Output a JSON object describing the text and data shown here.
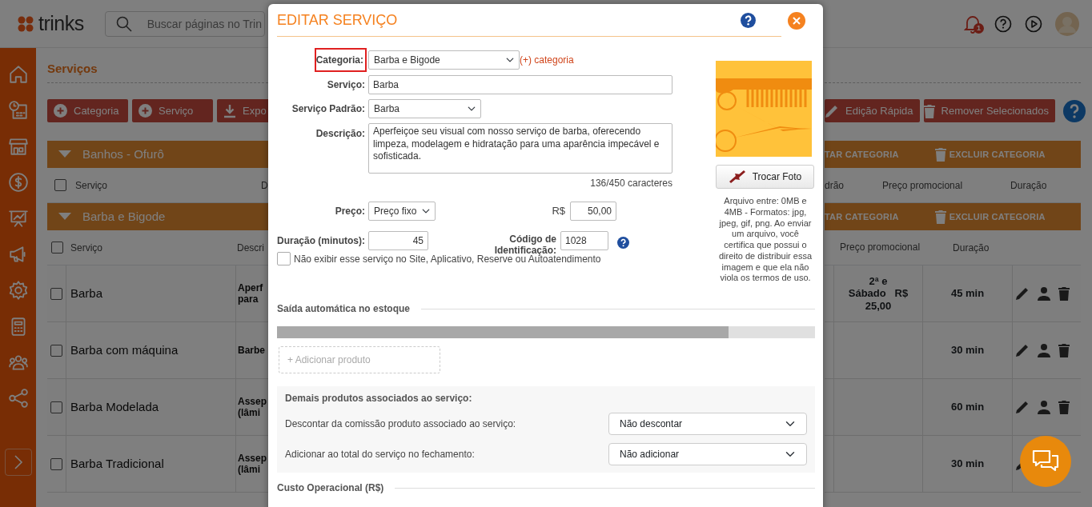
{
  "header": {
    "logo": "trinks",
    "search": {
      "placeholder": "Buscar páginas no Trin"
    },
    "notifications": "1"
  },
  "page": {
    "title": "Serviços",
    "toolbar_left": [
      {
        "label": "Categoria",
        "kind": "add"
      },
      {
        "label": "Serviço",
        "kind": "add"
      },
      {
        "label": "Expo",
        "kind": "export"
      }
    ],
    "toolbar_right": [
      {
        "label": "Edição Rápida",
        "kind": "edit"
      },
      {
        "label": "Remover Selecionados",
        "kind": "remove"
      }
    ],
    "categories": [
      {
        "name": "Banhos - Ofurô",
        "expanded": true,
        "edit_action": "TAR CATEGORIA",
        "delete_action": "EXCLUIR CATEGORIA",
        "all_checked": false,
        "columns_left": [
          "Serviço",
          "D"
        ],
        "columns_right": [
          "drão",
          "Preço promocional",
          "Duração"
        ]
      },
      {
        "name": "Barba e Bigode",
        "expanded": true,
        "edit_action": "TAR CATEGORIA",
        "delete_action": "EXCLUIR CATEGORIA",
        "all_checked": false,
        "columns_left": [
          "Serviço",
          "Descri"
        ],
        "columns_right": [
          "Preço promocional",
          "Duração"
        ],
        "rows": [
          {
            "name": "Barba",
            "checked": false,
            "description_lines": [
              "Aperf",
              "para"
            ],
            "promo_lines": [
              "2ª e",
              "Sábado   R$",
              "25,00"
            ],
            "duration": "45 min",
            "actions": [
              {
                "kind": "edit"
              },
              {
                "kind": "professional"
              },
              {
                "kind": "delete"
              }
            ]
          },
          {
            "name": "Barba com máquina",
            "checked": false,
            "description_lines": [
              "Barbe"
            ],
            "promo_lines": [],
            "duration": "30 min",
            "actions": [
              {
                "kind": "edit"
              },
              {
                "kind": "professional"
              },
              {
                "kind": "delete"
              }
            ]
          },
          {
            "name": "Barba Modelada",
            "checked": false,
            "description_lines": [
              "Assep",
              "(lâmi"
            ],
            "promo_lines": [],
            "duration": "60 min",
            "actions": [
              {
                "kind": "edit"
              },
              {
                "kind": "professional"
              },
              {
                "kind": "delete"
              }
            ]
          },
          {
            "name": "Barba Tradicional",
            "checked": false,
            "description_lines": [
              "Assep",
              "(lâmi"
            ],
            "promo_lines": [],
            "duration": "30 min",
            "actions": [
              {
                "kind": "edit"
              }
            ]
          }
        ]
      }
    ]
  },
  "modal": {
    "title": "EDITAR SERVIÇO",
    "categoria": {
      "label": "Categoria:",
      "value": "Barba e Bigode",
      "link": "(+) categoria",
      "highlighted": true
    },
    "servico": {
      "label": "Serviço:",
      "value": "Barba"
    },
    "servico_padrao": {
      "label": "Serviço Padrão:",
      "value": "Barba"
    },
    "descricao": {
      "label": "Descrição:",
      "value": "Aperfeiçoe seu visual com nosso serviço de barba, oferecendo limpeza, modelagem e hidratação para uma aparência impecável e sofisticada.",
      "counter": "136/450 caracteres"
    },
    "preco": {
      "label": "Preço:",
      "value": "Preço fixo",
      "currency": "R$",
      "amount": "50,00"
    },
    "duracao": {
      "label": "Duração (minutos):",
      "value": "45"
    },
    "codigo": {
      "label": "Código de Identificação:",
      "value": "1028"
    },
    "hide_option": {
      "label": "Não exibir esse serviço no Site, Aplicativo, Reserve ou Autoatendimento",
      "checked": false
    },
    "photo": {
      "kind": "picture",
      "button": "Trocar Foto",
      "note": "Arquivo entre: 0MB e 4MB - Formatos: jpg, jpeg, gif, png. Ao enviar um arquivo, você certifica que possui o direito de distribuir essa imagem e que ela não viola os",
      "link": "termos de uso",
      "note_end": "."
    },
    "stock": {
      "title": "Saída automática no estoque",
      "add_product": "+ Adicionar produto"
    },
    "associated": {
      "title": "Demais produtos associados ao serviço:",
      "options": [
        {
          "label": "Descontar da comissão produto associado ao serviço:",
          "value": "Não descontar"
        },
        {
          "label": "Adicionar ao total do serviço no fechamento:",
          "value": "Não adicionar"
        }
      ]
    },
    "operational_cost": {
      "title": "Custo Operacional (R$)"
    }
  }
}
